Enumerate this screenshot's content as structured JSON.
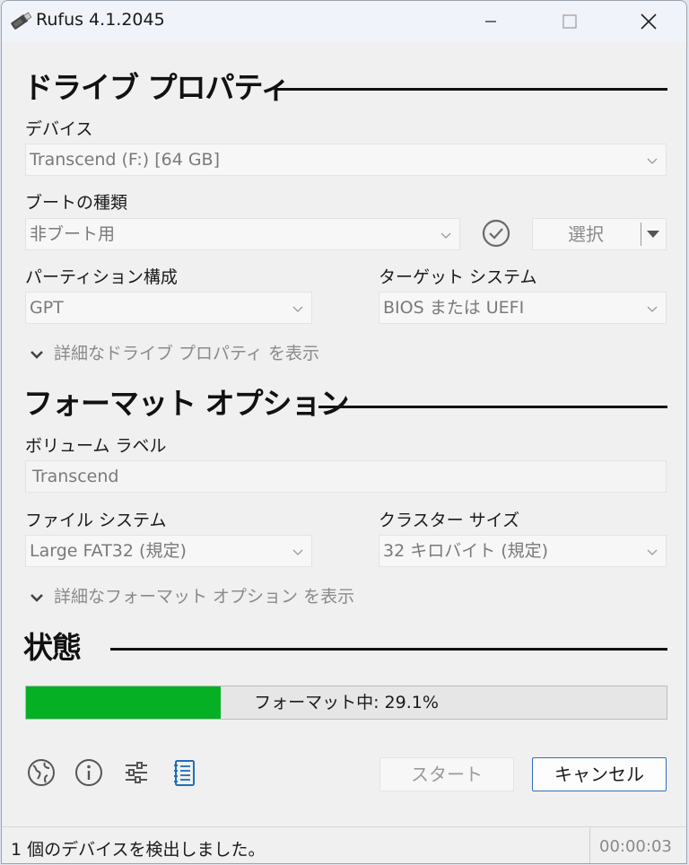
{
  "window": {
    "title": "Rufus 4.1.2045"
  },
  "drive": {
    "heading": "ドライブ プロパティ",
    "device_label": "デバイス",
    "device_value": "Transcend (F:) [64 GB]",
    "boot_label": "ブートの種類",
    "boot_value": "非ブート用",
    "select_label": "選択",
    "partition_label": "パーティション構成",
    "partition_value": "GPT",
    "target_label": "ターゲット システム",
    "target_value": "BIOS または UEFI",
    "advanced_label": "詳細なドライブ プロパティ を表示"
  },
  "format": {
    "heading": "フォーマット オプション",
    "volume_label": "ボリューム ラベル",
    "volume_value": "Transcend",
    "fs_label": "ファイル システム",
    "fs_value": "Large FAT32 (規定)",
    "cluster_label": "クラスター サイズ",
    "cluster_value": "32 キロバイト (規定)",
    "advanced_label": "詳細なフォーマット オプション を表示"
  },
  "status": {
    "heading": "状態",
    "progress_text": "フォーマット中: 29.1%",
    "progress_fraction": 0.304,
    "progress_color": "#06b025"
  },
  "toolbar": {
    "icons": [
      "globe-icon",
      "info-icon",
      "settings-icon",
      "log-icon"
    ],
    "start_label": "スタート",
    "cancel_label": "キャンセル"
  },
  "statusbar": {
    "message": "1 個のデバイスを検出しました。",
    "timer": "00:00:03"
  }
}
